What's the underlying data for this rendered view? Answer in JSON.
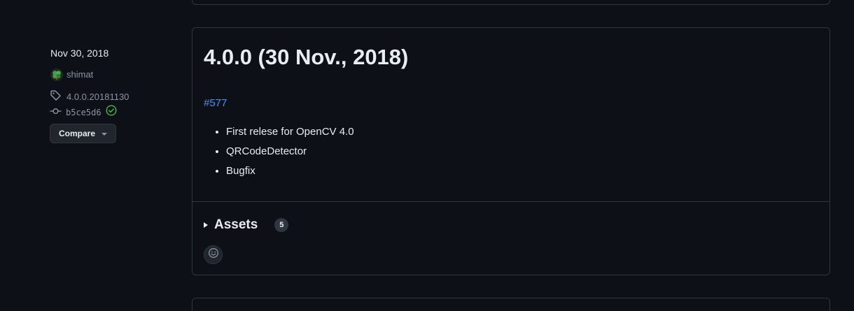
{
  "sidebar": {
    "date": "Nov 30, 2018",
    "author": "shimat",
    "tag": "4.0.0.20181130",
    "commit": "b5ce5d6",
    "compare_label": "Compare"
  },
  "release": {
    "title": "4.0.0 (30 Nov., 2018)",
    "pr_link": "#577",
    "notes": [
      "First relese for OpenCV 4.0",
      "QRCodeDetector",
      "Bugfix"
    ],
    "assets_label": "Assets",
    "assets_count": "5"
  },
  "colors": {
    "background": "#0d1117",
    "border": "#30363d",
    "link": "#4493f8",
    "muted": "#8b949e",
    "verified": "#3fb950"
  },
  "icons": [
    "avatar-clover-icon",
    "tag-icon",
    "commit-icon",
    "verified-check-icon",
    "caret-down-icon",
    "triangle-right-icon",
    "smiley-icon"
  ]
}
